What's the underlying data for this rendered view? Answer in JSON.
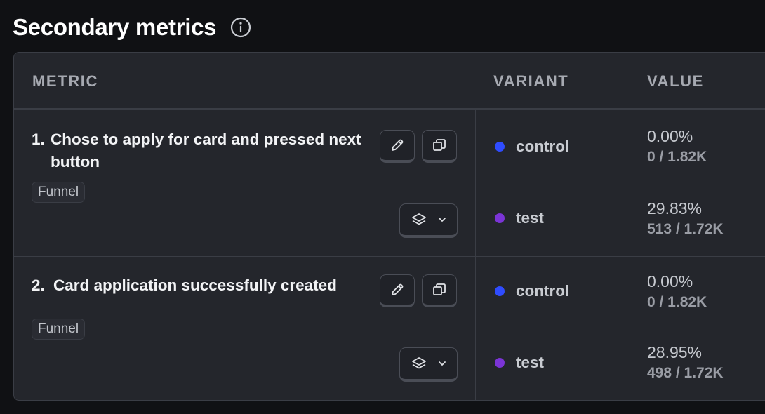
{
  "header": {
    "title": "Secondary metrics",
    "info_icon": "info-circle-icon"
  },
  "table": {
    "columns": [
      "METRIC",
      "VARIANT",
      "VALUE"
    ],
    "colors": {
      "control": "#2f4cff",
      "test": "#7b34d6"
    },
    "rows": [
      {
        "number": "1.",
        "title": "Chose to apply for card and pressed next button",
        "badge": "Funnel",
        "variants": [
          {
            "name": "control",
            "percent": "0.00%",
            "fraction": "0 / 1.82K"
          },
          {
            "name": "test",
            "percent": "29.83%",
            "fraction": "513 / 1.72K"
          }
        ]
      },
      {
        "number": "2.",
        "title": "Card application successfully created",
        "badge": "Funnel",
        "variants": [
          {
            "name": "control",
            "percent": "0.00%",
            "fraction": "0 / 1.82K"
          },
          {
            "name": "test",
            "percent": "28.95%",
            "fraction": "498 / 1.72K"
          }
        ]
      }
    ],
    "icons": {
      "edit": "pencil-icon",
      "duplicate": "copy-icon",
      "layers": "layers-icon",
      "dropdown": "chevron-down-icon"
    }
  }
}
